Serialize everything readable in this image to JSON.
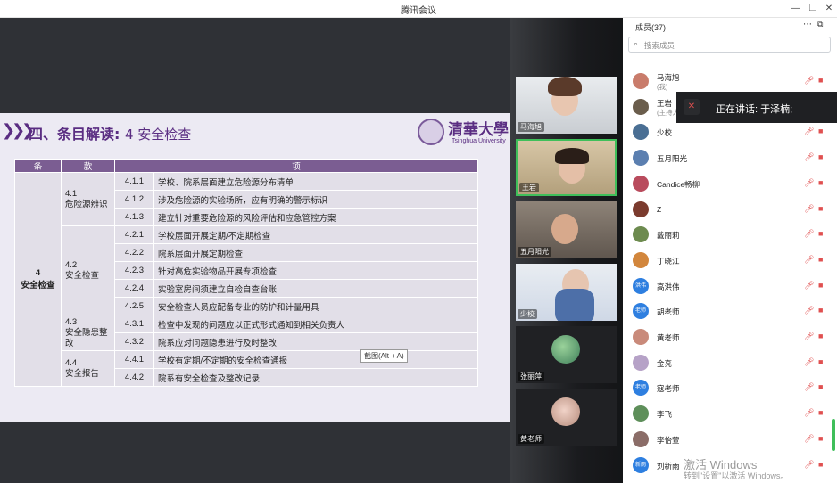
{
  "window": {
    "title": "腾讯会议",
    "controls": [
      "—",
      "❐",
      "✕"
    ]
  },
  "slide": {
    "heading_main": "四、条目解读:",
    "heading_sub": "4 安全检查",
    "logo_cn": "清華大學",
    "logo_en": "Tsinghua University",
    "table_headers": [
      "条",
      "款",
      "项"
    ],
    "tiao": "4\n安全检查",
    "groups": [
      {
        "kuan": "4.1\n危险源辨识",
        "items": [
          {
            "num": "4.1.1",
            "text": "学校、院系层面建立危险源分布清单"
          },
          {
            "num": "4.1.2",
            "text": "涉及危险源的实验场所，应有明确的警示标识"
          },
          {
            "num": "4.1.3",
            "text": "建立针对重要危险源的风险评估和应急管控方案"
          }
        ]
      },
      {
        "kuan": "4.2\n安全检查",
        "items": [
          {
            "num": "4.2.1",
            "text": "学校层面开展定期/不定期检查"
          },
          {
            "num": "4.2.2",
            "text": "院系层面开展定期检查"
          },
          {
            "num": "4.2.3",
            "text": "针对高危实验物品开展专项检查"
          },
          {
            "num": "4.2.4",
            "text": "实验室房间须建立自检自查台账"
          },
          {
            "num": "4.2.5",
            "text": "安全检查人员应配备专业的防护和计量用具"
          }
        ]
      },
      {
        "kuan": "4.3\n安全隐患整改",
        "items": [
          {
            "num": "4.3.1",
            "text": "检查中发现的问题应以正式形式通知到相关负责人"
          },
          {
            "num": "4.3.2",
            "text": "院系应对问题隐患进行及时整改"
          }
        ]
      },
      {
        "kuan": "4.4\n安全报告",
        "items": [
          {
            "num": "4.4.1",
            "text": "学校有定期/不定期的安全检查通报"
          },
          {
            "num": "4.4.2",
            "text": "院系有安全检查及整改记录"
          }
        ]
      }
    ]
  },
  "tooltip": "截图(Alt + A)",
  "videos": [
    {
      "name": "马海旭",
      "kind": "video"
    },
    {
      "name": "王岩",
      "kind": "video",
      "active": true
    },
    {
      "name": "五月阳光",
      "kind": "video"
    },
    {
      "name": "少校",
      "kind": "video"
    },
    {
      "name": "张丽萍",
      "kind": "avatar"
    },
    {
      "name": "黄老师",
      "kind": "avatar"
    }
  ],
  "members": {
    "header": "成员(37)",
    "search_placeholder": "搜索成员",
    "list": [
      {
        "name": "马海旭",
        "sub": "(我)",
        "avatar_text": "",
        "color": "#c97c6b"
      },
      {
        "name": "王岩",
        "sub": "(主持人)",
        "avatar_text": "",
        "color": "#6a5d4c"
      },
      {
        "name": "少校",
        "sub": "",
        "avatar_text": "",
        "color": "#4a6f94"
      },
      {
        "name": "五月阳光",
        "sub": "",
        "avatar_text": "",
        "color": "#5b7fb0"
      },
      {
        "name": "Candice畅柳",
        "sub": "",
        "avatar_text": "",
        "color": "#b94b5d"
      },
      {
        "name": "Z",
        "sub": "",
        "avatar_text": "",
        "color": "#7b3b2e"
      },
      {
        "name": "戴丽莉",
        "sub": "",
        "avatar_text": "",
        "color": "#6d8b4f"
      },
      {
        "name": "丁晓江",
        "sub": "",
        "avatar_text": "",
        "color": "#d2863c"
      },
      {
        "name": "高洪伟",
        "sub": "",
        "avatar_text": "洪伟",
        "color": "#2e7fe0"
      },
      {
        "name": "胡老师",
        "sub": "",
        "avatar_text": "老师",
        "color": "#2e7fe0"
      },
      {
        "name": "黄老师",
        "sub": "",
        "avatar_text": "",
        "color": "#c98a7a"
      },
      {
        "name": "金亮",
        "sub": "",
        "avatar_text": "",
        "color": "#b6a2c7"
      },
      {
        "name": "寇老师",
        "sub": "",
        "avatar_text": "老师",
        "color": "#2e7fe0"
      },
      {
        "name": "李飞",
        "sub": "",
        "avatar_text": "",
        "color": "#5e8f5a"
      },
      {
        "name": "李怡萱",
        "sub": "",
        "avatar_text": "",
        "color": "#8b6d68"
      },
      {
        "name": "刘新雨",
        "sub": "",
        "avatar_text": "新雨",
        "color": "#2e7fe0"
      }
    ]
  },
  "speaking": "正在讲话: 于泽楠;",
  "watermark": {
    "line1": "激活 Windows",
    "line2": "转到\"设置\"以激活 Windows。"
  },
  "icons": {
    "mic_muted": "mic-muted-icon",
    "cam_off": "camera-off-icon",
    "search": "search-icon"
  }
}
